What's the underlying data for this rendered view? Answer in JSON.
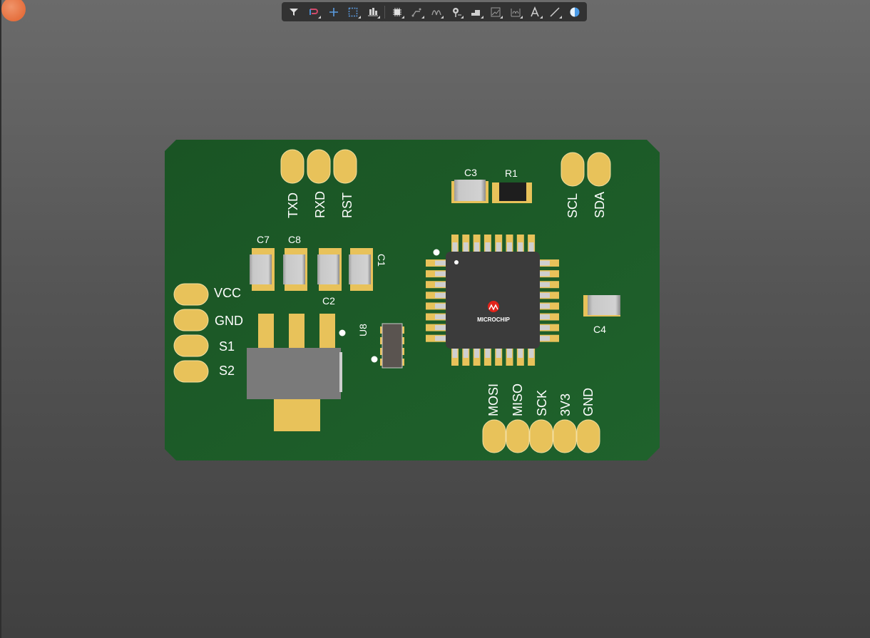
{
  "toolbar": {
    "icons": [
      "filter-icon",
      "route-interactive-icon",
      "add-cross-icon",
      "select-rect-icon",
      "align-icon",
      "place-component-icon",
      "route-arc-icon",
      "route-multi-icon",
      "place-via-icon",
      "place-fill-icon",
      "graph-icon",
      "place-fill-arc-icon",
      "text-icon",
      "line-icon",
      "sphere-icon"
    ]
  },
  "board": {
    "header_pins": [
      {
        "label": "TXD"
      },
      {
        "label": "RXD"
      },
      {
        "label": "RST"
      }
    ],
    "i2c_pins": [
      {
        "label": "SCL"
      },
      {
        "label": "SDA"
      }
    ],
    "power_pins": [
      {
        "label": "VCC"
      },
      {
        "label": "GND"
      },
      {
        "label": "S1"
      },
      {
        "label": "S2"
      }
    ],
    "spi_pins": [
      {
        "label": "MOSI"
      },
      {
        "label": "MISO"
      },
      {
        "label": "SCK"
      },
      {
        "label": "3V3"
      },
      {
        "label": "GND"
      }
    ],
    "components": {
      "c1": "C1",
      "c2": "C2",
      "c3": "C3",
      "c4": "C4",
      "c7": "C7",
      "c8": "C8",
      "r1": "R1",
      "u8": "U8"
    },
    "chip_logo": "MICROCHIP",
    "colors": {
      "pcb": "#1b5a27",
      "pad": "#e8c25a",
      "chip": "#3b3b3b"
    }
  }
}
